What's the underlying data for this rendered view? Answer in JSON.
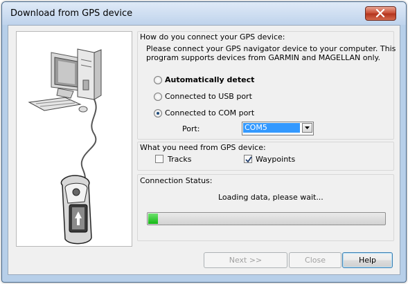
{
  "window": {
    "title": "Download from GPS device"
  },
  "connect": {
    "group_label": "How do you connect your GPS device:",
    "description_line1": "Please connect your GPS navigator device to your computer. This",
    "description_line2": "program supports devices from GARMIN and MAGELLAN only.",
    "options": [
      {
        "label": "Automatically detect",
        "selected": false
      },
      {
        "label": "Connected to USB port",
        "selected": false
      },
      {
        "label": "Connected to COM port",
        "selected": true
      }
    ],
    "port_label": "Port:",
    "port_value": "COM5"
  },
  "needs": {
    "group_label": "What you need from GPS device:",
    "tracks_label": "Tracks",
    "tracks_checked": false,
    "waypoints_label": "Waypoints",
    "waypoints_checked": true
  },
  "status": {
    "group_label": "Connection Status:",
    "message": "Loading data, please wait...",
    "progress": 0.04
  },
  "buttons": {
    "next": "Next >>",
    "close": "Close",
    "help": "Help"
  },
  "colors": {
    "progress_fill": "#14b814",
    "selection": "#3399ff"
  }
}
